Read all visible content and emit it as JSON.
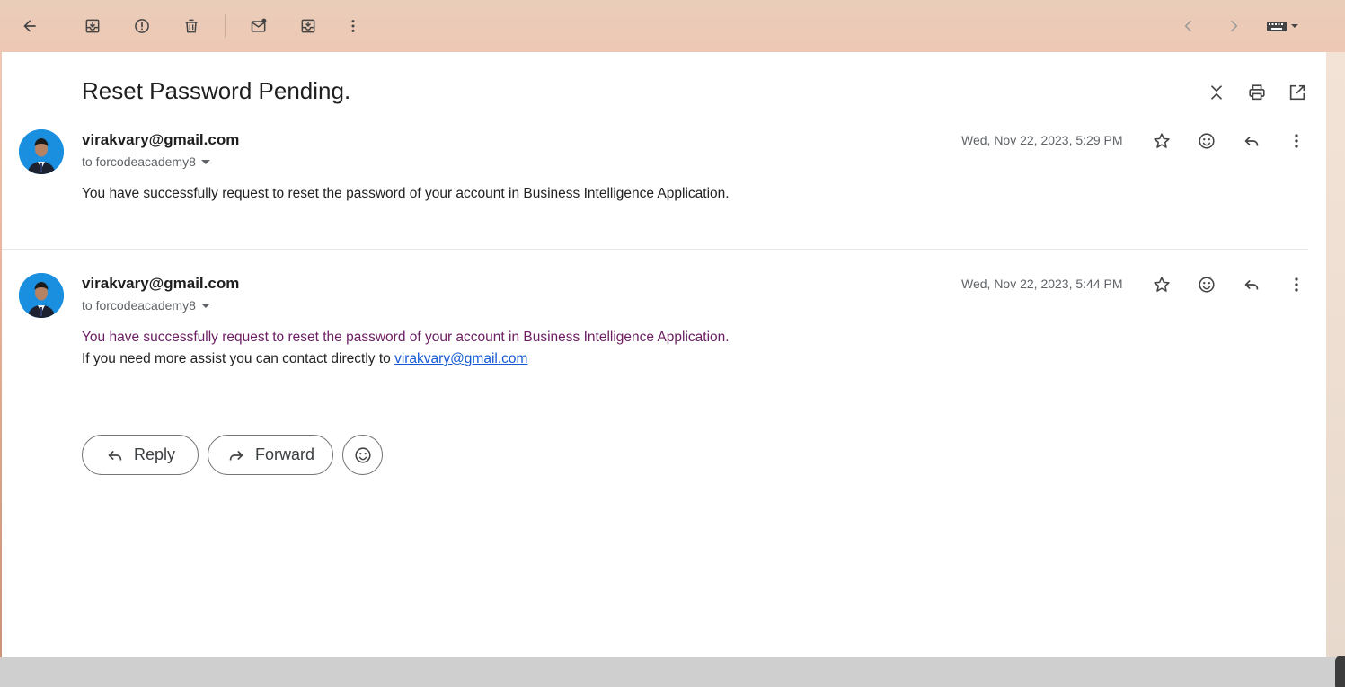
{
  "toolbar": {
    "items": [
      "back-icon",
      "archive-icon",
      "report-spam-icon",
      "delete-icon",
      "mark-unread-icon",
      "move-to-icon",
      "more-vert-icon"
    ],
    "right_items": [
      "newer-icon",
      "older-icon",
      "keyboard-icon"
    ]
  },
  "email": {
    "subject": "Reset Password Pending.",
    "header_actions": [
      "collapse-all-icon",
      "print-icon",
      "open-new-window-icon"
    ]
  },
  "messages": [
    {
      "sender": "virakvary@gmail.com",
      "to": "to forcodeacademy8",
      "date": "Wed, Nov 22, 2023, 5:29 PM",
      "body_line1": "You have successfully request to reset the password of your account in Business Intelligence Application."
    },
    {
      "sender": "virakvary@gmail.com",
      "to": "to forcodeacademy8",
      "date": "Wed, Nov 22, 2023, 5:44 PM",
      "body_line1": "You have successfully request to reset the password of your account in Business Intelligence Application.",
      "body_line2_prefix": "If you need more assist you can contact directly to ",
      "body_link": "virakvary@gmail.com"
    }
  ],
  "actions": {
    "reply_label": "Reply",
    "forward_label": "Forward"
  },
  "colors": {
    "link": "#1558d6",
    "quoted_text": "#6b1d62",
    "avatar_bg": "#1a8fe0"
  }
}
